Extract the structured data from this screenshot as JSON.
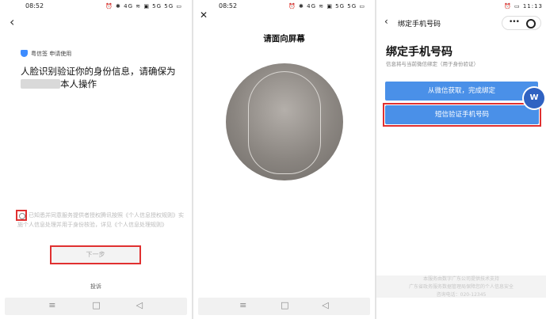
{
  "panel1": {
    "status_time": "08:52",
    "status_icons": "⏰ ✱ 4G ≋ ▣ 5G 5G ▭",
    "auth_text": "粤信签 申请使用",
    "headline_pre": "人脸识别验证你的身份信息，请确保为",
    "headline_post": "本人操作",
    "agreement_text": "已知悉并同意服务提供者授权腾讯按照《个人信息授权规则》实施个人信息处理并用于身份核验，详见《个人信息处理规则》",
    "next_label": "下一步",
    "complain_label": "投诉"
  },
  "panel2": {
    "status_time": "08:52",
    "status_icons": "⏰ ✱ 4G ≋ ▣ 5G 5G ▭",
    "close_label": "✕",
    "title": "请面向屏幕"
  },
  "panel3": {
    "status_time": "11:13",
    "status_icons": "⏰ ▭",
    "nav_title": "绑定手机号码",
    "heading": "绑定手机号码",
    "subtitle": "信息将与当前微信绑定（用于身份验证）",
    "wechat_button": "从微信获取，完成绑定",
    "sms_button": "短信验证手机号码",
    "badge_letter": "W",
    "footer_lines": [
      "本服务由数字广东公司提供技术支持",
      "广东省政务服务数据管理局保障您的个人信息安全",
      "咨询电话：020-12345"
    ]
  },
  "colors": {
    "accent_blue": "#4a90e8",
    "highlight_red": "#e03030"
  },
  "icons": [
    "back-arrow-icon",
    "shield-icon",
    "close-icon",
    "more-dots-icon",
    "target-icon",
    "menu-nav-icon",
    "home-nav-icon",
    "back-nav-icon"
  ]
}
